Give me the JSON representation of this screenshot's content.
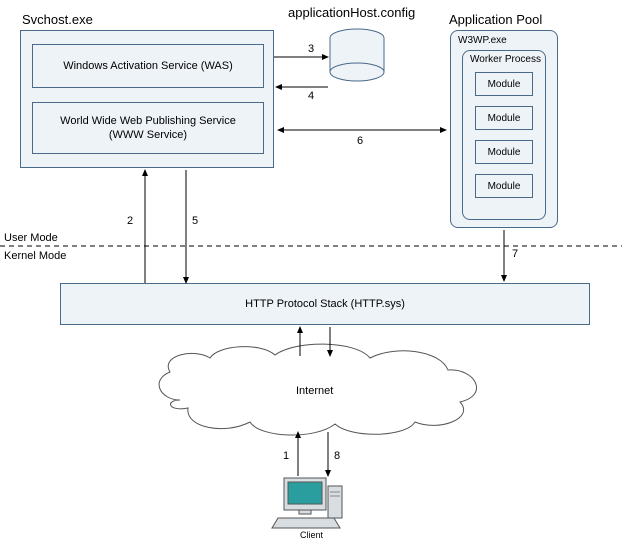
{
  "labels": {
    "svchost": "Svchost.exe",
    "appHostConfig": "applicationHost.config",
    "appPool": "Application Pool",
    "w3wp": "W3WP.exe",
    "workerProcess": "Worker Process",
    "was": "Windows Activation Service (WAS)",
    "wwwService": "World Wide Web Publishing Service\n(WWW Service)",
    "userMode": "User Mode",
    "kernelMode": "Kernel Mode",
    "httpSys": "HTTP Protocol Stack (HTTP.sys)",
    "internet": "Internet",
    "client": "Client",
    "module": "Module"
  },
  "steps": {
    "s1": "1",
    "s2": "2",
    "s3": "3",
    "s4": "4",
    "s5": "5",
    "s6": "6",
    "s7": "7",
    "s8": "8"
  },
  "chart_data": {
    "type": "diagram",
    "title": "IIS Request Processing / Architecture",
    "nodes": [
      {
        "id": "svchost",
        "label": "Svchost.exe",
        "zone": "User Mode",
        "children": [
          {
            "id": "was",
            "label": "Windows Activation Service (WAS)"
          },
          {
            "id": "www",
            "label": "World Wide Web Publishing Service (WWW Service)"
          }
        ]
      },
      {
        "id": "apphostconfig",
        "label": "applicationHost.config",
        "zone": "User Mode",
        "shape": "cylinder"
      },
      {
        "id": "apppool",
        "label": "Application Pool",
        "zone": "User Mode",
        "children": [
          {
            "id": "w3wp",
            "label": "W3WP.exe",
            "children": [
              {
                "id": "workerprocess",
                "label": "Worker Process",
                "children": [
                  {
                    "id": "module1",
                    "label": "Module"
                  },
                  {
                    "id": "module2",
                    "label": "Module"
                  },
                  {
                    "id": "module3",
                    "label": "Module"
                  },
                  {
                    "id": "module4",
                    "label": "Module"
                  }
                ]
              }
            ]
          }
        ]
      },
      {
        "id": "httpsys",
        "label": "HTTP Protocol Stack (HTTP.sys)",
        "zone": "Kernel Mode"
      },
      {
        "id": "internet",
        "label": "Internet",
        "zone": "Kernel Mode",
        "shape": "cloud"
      },
      {
        "id": "client",
        "label": "Client",
        "zone": "Kernel Mode",
        "shape": "computer"
      }
    ],
    "edges": [
      {
        "step": 1,
        "from": "client",
        "to": "internet",
        "direction": "up"
      },
      {
        "step": 2,
        "from": "httpsys",
        "to": "svchost",
        "direction": "up"
      },
      {
        "step": 3,
        "from": "was",
        "to": "apphostconfig",
        "direction": "right"
      },
      {
        "step": 4,
        "from": "apphostconfig",
        "to": "was",
        "direction": "left"
      },
      {
        "step": 5,
        "from": "svchost",
        "to": "httpsys",
        "direction": "down"
      },
      {
        "step": 6,
        "from": "www",
        "to": "apppool",
        "direction": "both"
      },
      {
        "step": 7,
        "from": "apppool",
        "to": "httpsys",
        "direction": "down"
      },
      {
        "step": 8,
        "from": "internet",
        "to": "client",
        "direction": "down"
      }
    ],
    "zones": [
      "User Mode",
      "Kernel Mode"
    ]
  }
}
